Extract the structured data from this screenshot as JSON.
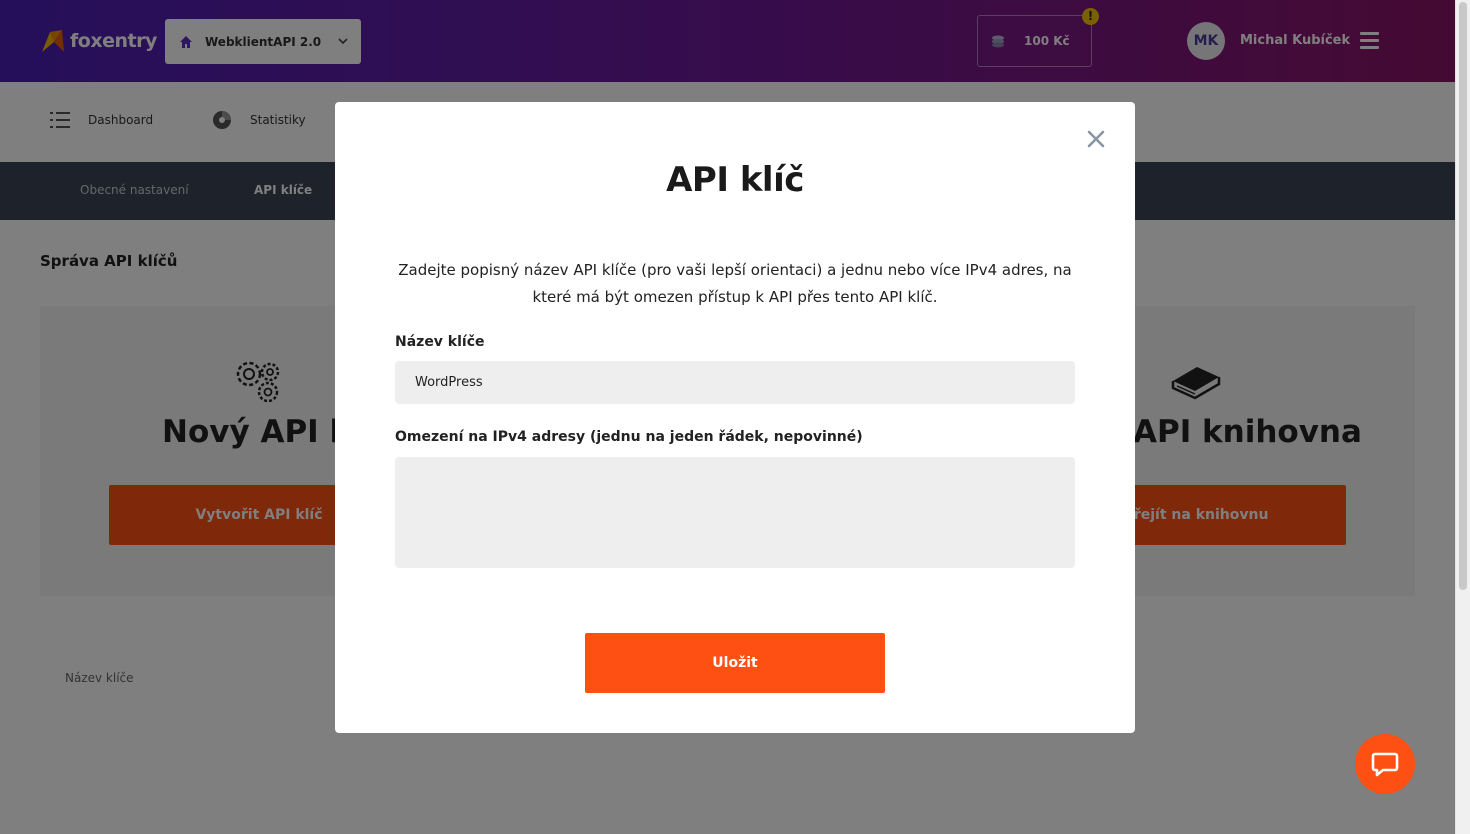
{
  "header": {
    "logo_text": "foxentry",
    "project_name": "WebklientAPI 2.0",
    "credit": "100 Kč",
    "alert_mark": "!",
    "user_initials": "MK",
    "user_name": "Michal Kubíček"
  },
  "nav": {
    "items": [
      {
        "label": "Dashboard",
        "icon": "list-icon"
      },
      {
        "label": "Statistiky",
        "icon": "pie-chart-icon"
      }
    ]
  },
  "tabs": [
    {
      "label": "Obecné nastavení",
      "active": false
    },
    {
      "label": "API klíče",
      "active": true
    }
  ],
  "page": {
    "section_title": "Správa API klíčů",
    "cards": [
      {
        "heading": "Nový API klíč",
        "button": "Vytvořit API klíč",
        "icon": "gears-icon"
      },
      {
        "heading": "API knihovna",
        "button": "Přejít na knihovnu",
        "icon": "book-icon"
      }
    ],
    "table_header": "Název klíče"
  },
  "modal": {
    "title": "API klíč",
    "description": "Zadejte popisný název API klíče (pro vaši lepší orientaci) a jednu nebo více IPv4 adres, na které má být omezen přístup k API přes tento API klíč.",
    "name_label": "Název klíče",
    "name_value": "WordPress",
    "ip_label": "Omezení na IPv4 adresy (jednu na jeden řádek, nepovinné)",
    "ip_value": "",
    "save_label": "Uložit"
  },
  "colors": {
    "accent": "#ff5014",
    "header_gradient_start": "#4b1fb5",
    "header_gradient_end": "#8a1567",
    "tabs_bar": "#3a4456"
  }
}
